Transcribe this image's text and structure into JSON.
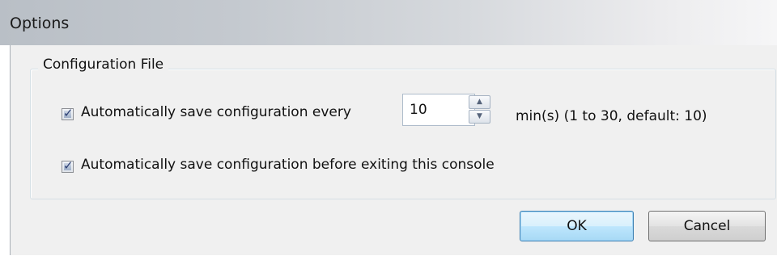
{
  "window": {
    "title": "Options"
  },
  "group": {
    "title": "Configuration File"
  },
  "auto_save": {
    "checked": true,
    "label": "Automatically save configuration every",
    "interval_value": "10",
    "unit_hint": "min(s) (1 to 30, default: 10)"
  },
  "save_on_exit": {
    "checked": true,
    "label": "Automatically save configuration before exiting this console"
  },
  "buttons": {
    "ok_label": "OK",
    "cancel_label": "Cancel"
  },
  "icons": {
    "spin_up": "spin-up-arrow-icon",
    "spin_down": "spin-down-arrow-icon",
    "check": "checkmark-icon"
  },
  "colors": {
    "default_button_border": "#3c7fb1",
    "checkmark": "#2d3f73"
  }
}
